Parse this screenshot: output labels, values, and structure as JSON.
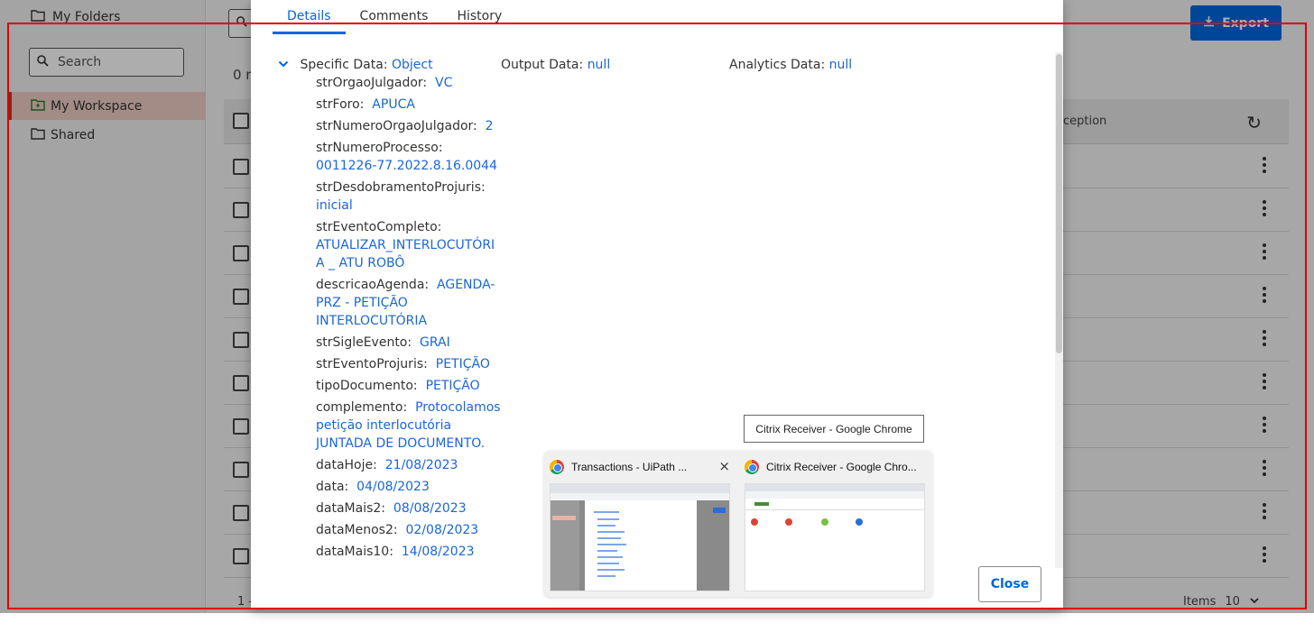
{
  "app": {
    "sidebar": {
      "title": "My Folders",
      "search_placeholder": "Search",
      "items": [
        {
          "label": "My Workspace",
          "active": true
        },
        {
          "label": "Shared",
          "active": false
        }
      ]
    },
    "main": {
      "count_text": "0 r",
      "export_label": "Export",
      "table_header_fragment": "ception",
      "row_count": 10,
      "pager_left": "1 -",
      "items_label": "Items",
      "items_value": "10"
    }
  },
  "modal": {
    "tabs": [
      {
        "label": "Details",
        "active": true
      },
      {
        "label": "Comments",
        "active": false
      },
      {
        "label": "History",
        "active": false
      }
    ],
    "specific": {
      "key": "Specific Data:",
      "value": "Object"
    },
    "output": {
      "key": "Output Data:",
      "value": "null"
    },
    "analytics": {
      "key": "Analytics Data:",
      "value": "null"
    },
    "fields": [
      {
        "key": "strOrgaoJulgador:",
        "value": "VC"
      },
      {
        "key": "strForo:",
        "value": "APUCA"
      },
      {
        "key": "strNumeroOrgaoJulgador:",
        "value": "2"
      },
      {
        "key": "strNumeroProcesso:",
        "value": "0011226-77.2022.8.16.0044"
      },
      {
        "key": "strDesdobramentoProjuris:",
        "value": "inicial"
      },
      {
        "key": "strEventoCompleto:",
        "value": "ATUALIZAR_INTERLOCUTÓRIA _ ATU ROBÔ"
      },
      {
        "key": "descricaoAgenda:",
        "value": "AGENDA-PRZ - PETIÇÃO INTERLOCUTÓRIA"
      },
      {
        "key": "strSigleEvento:",
        "value": "GRAI"
      },
      {
        "key": "strEventoProjuris:",
        "value": "PETIÇÃO"
      },
      {
        "key": "tipoDocumento:",
        "value": "PETIÇÃO"
      },
      {
        "key": "complemento:",
        "value": "Protocolamos petição interlocutória JUNTADA DE DOCUMENTO."
      },
      {
        "key": "dataHoje:",
        "value": "21/08/2023"
      },
      {
        "key": "data:",
        "value": "04/08/2023"
      },
      {
        "key": "dataMais2:",
        "value": "08/08/2023"
      },
      {
        "key": "dataMenos2:",
        "value": "02/08/2023"
      },
      {
        "key": "dataMais10:",
        "value": "14/08/2023"
      }
    ],
    "close_label": "Close"
  },
  "taskbar": {
    "tooltip": "Citrix Receiver - Google Chrome",
    "previews": [
      {
        "title": "Transactions - UiPath ...",
        "close": "×"
      },
      {
        "title": "Citrix Receiver - Google Chro..."
      }
    ]
  },
  "colors": {
    "accent": "#0067df",
    "value_text": "#1a66d6",
    "active_folder_bg": "#f1cfc4",
    "capture_border": "#e00000"
  }
}
